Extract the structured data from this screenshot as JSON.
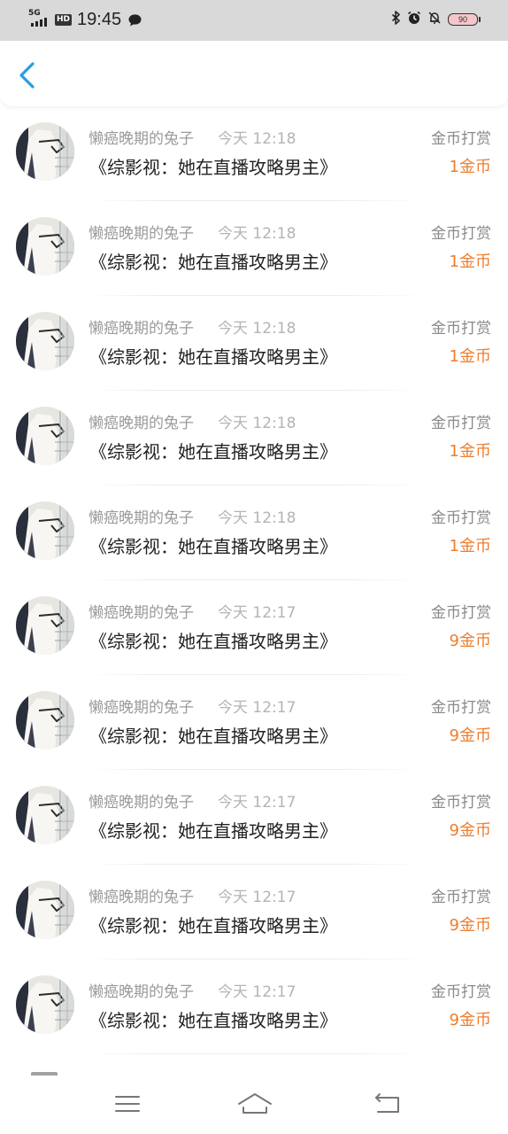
{
  "status_bar": {
    "network": "5G",
    "hd": "HD",
    "time": "19:45",
    "battery": "90",
    "icons": [
      "message-icon",
      "bluetooth-icon",
      "alarm-icon",
      "mute-icon"
    ]
  },
  "header": {
    "back_icon": "chevron-left-icon",
    "accent_color": "#2a9ee0"
  },
  "colors": {
    "amount": "#ee7d2e",
    "name": "#9a9a9a",
    "time": "#b4b4b4",
    "title": "#222222"
  },
  "records": [
    {
      "user": "懒癌晚期的兔子",
      "time": "今天 12:18",
      "title": "《综影视：她在直播攻略男主》",
      "type": "金币打赏",
      "amount": "1金币"
    },
    {
      "user": "懒癌晚期的兔子",
      "time": "今天 12:18",
      "title": "《综影视：她在直播攻略男主》",
      "type": "金币打赏",
      "amount": "1金币"
    },
    {
      "user": "懒癌晚期的兔子",
      "time": "今天 12:18",
      "title": "《综影视：她在直播攻略男主》",
      "type": "金币打赏",
      "amount": "1金币"
    },
    {
      "user": "懒癌晚期的兔子",
      "time": "今天 12:18",
      "title": "《综影视：她在直播攻略男主》",
      "type": "金币打赏",
      "amount": "1金币"
    },
    {
      "user": "懒癌晚期的兔子",
      "time": "今天 12:18",
      "title": "《综影视：她在直播攻略男主》",
      "type": "金币打赏",
      "amount": "1金币"
    },
    {
      "user": "懒癌晚期的兔子",
      "time": "今天 12:17",
      "title": "《综影视：她在直播攻略男主》",
      "type": "金币打赏",
      "amount": "9金币"
    },
    {
      "user": "懒癌晚期的兔子",
      "time": "今天 12:17",
      "title": "《综影视：她在直播攻略男主》",
      "type": "金币打赏",
      "amount": "9金币"
    },
    {
      "user": "懒癌晚期的兔子",
      "time": "今天 12:17",
      "title": "《综影视：她在直播攻略男主》",
      "type": "金币打赏",
      "amount": "9金币"
    },
    {
      "user": "懒癌晚期的兔子",
      "time": "今天 12:17",
      "title": "《综影视：她在直播攻略男主》",
      "type": "金币打赏",
      "amount": "9金币"
    },
    {
      "user": "懒癌晚期的兔子",
      "time": "今天 12:17",
      "title": "《综影视：她在直播攻略男主》",
      "type": "金币打赏",
      "amount": "9金币"
    }
  ],
  "nav_bar": {
    "icons": [
      "menu-icon",
      "home-icon",
      "back-icon"
    ]
  }
}
